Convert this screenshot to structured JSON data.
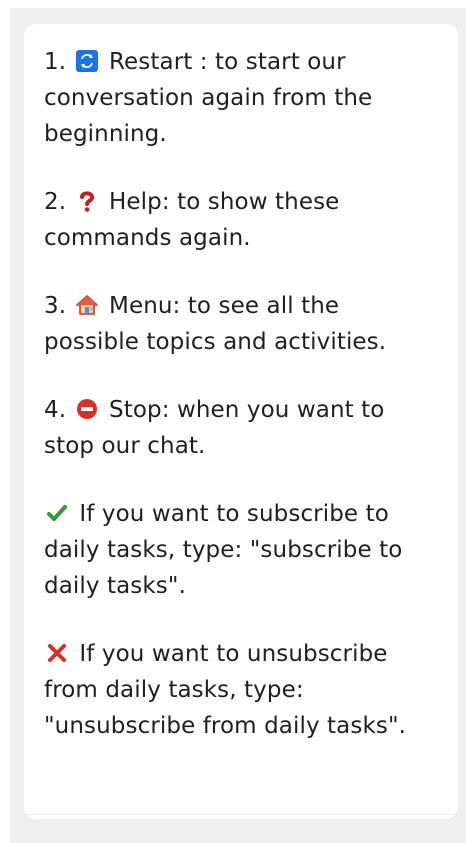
{
  "message": {
    "items": [
      {
        "prefix": "1.",
        "icon": "restart-icon",
        "text": "Restart : to start our conversation again from the beginning."
      },
      {
        "prefix": "2.",
        "icon": "question-mark-icon",
        "text": "Help: to show these commands again."
      },
      {
        "prefix": "3.",
        "icon": "house-icon",
        "text": "Menu: to see all the possible topics and activities."
      },
      {
        "prefix": "4.",
        "icon": "no-entry-icon",
        "text": "Stop: when you want to stop our chat."
      },
      {
        "prefix": "",
        "icon": "check-mark-icon",
        "text": "If you want to subscribe to daily tasks, type: \"subscribe to daily tasks\"."
      },
      {
        "prefix": "",
        "icon": "cross-mark-icon",
        "text": "If you want to unsubscribe from daily tasks, type: \"unsubscribe from daily tasks\"."
      }
    ]
  },
  "colors": {
    "restart": "#1a73e8",
    "question": "#c81e1e",
    "no_entry": "#d93025",
    "check": "#2e9c3a",
    "cross": "#d93025"
  }
}
